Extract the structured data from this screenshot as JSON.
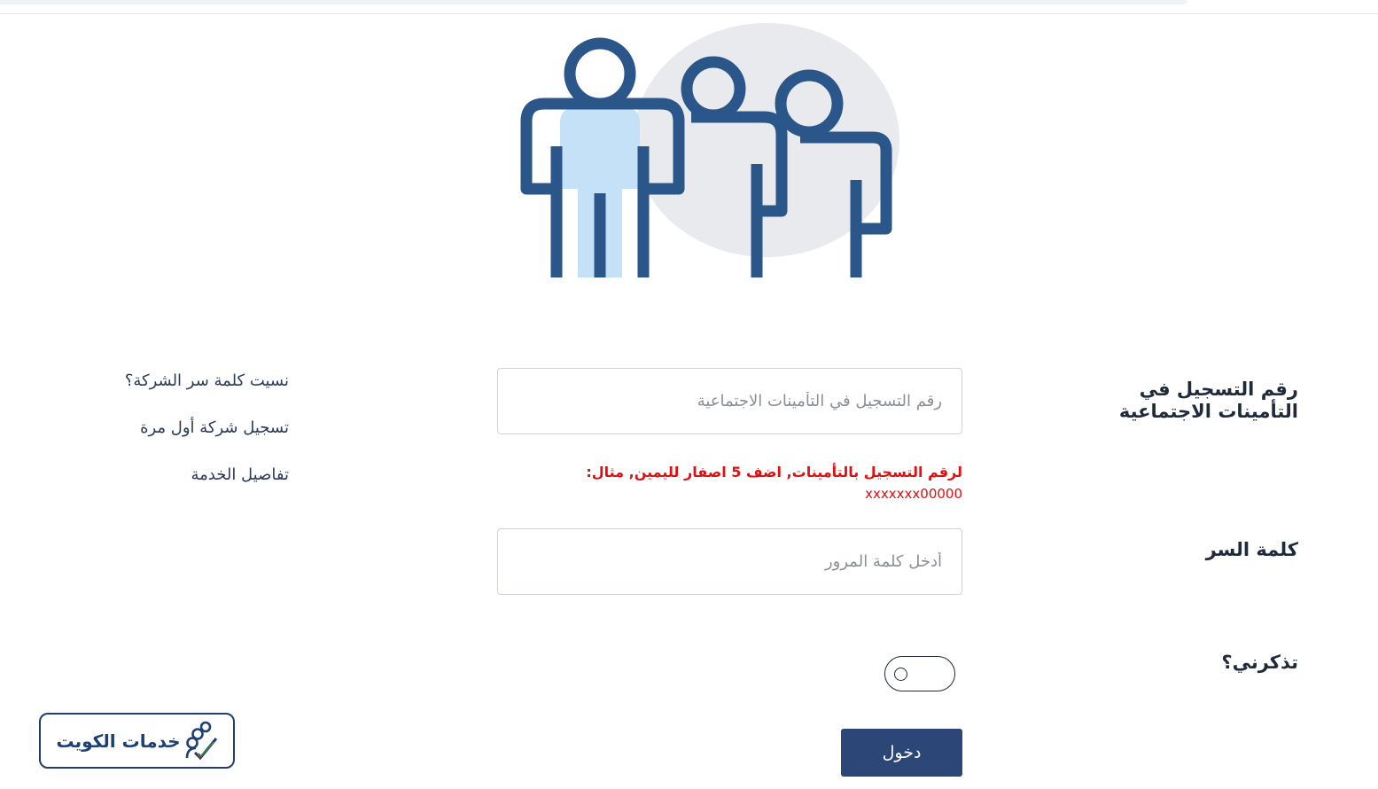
{
  "form": {
    "registration_label": "رقم التسجيل في التأمينات الاجتماعية",
    "registration_placeholder": "رقم التسجيل في التأمينات الاجتماعية",
    "registration_value": "",
    "hint_line1": "لرقم التسجيل بالتأمينات, اضف 5 اصفار لليمين, مثال:",
    "hint_line2": "xxxxxxx00000",
    "password_label": "كلمة السر",
    "password_placeholder": "أدخل كلمة المرور",
    "password_value": "",
    "remember_label": "تذكرني؟",
    "remember_checked": false,
    "login_button": "دخول"
  },
  "links": [
    {
      "label": "نسيت كلمة سر الشركة؟"
    },
    {
      "label": "تسجيل شركة أول مرة"
    },
    {
      "label": "تفاصيل الخدمة"
    }
  ],
  "watermark": {
    "text": "خدمات الكويت"
  },
  "colors": {
    "primary": "#2b4677",
    "error": "#e01010",
    "illustration_stroke": "#2a568a",
    "illustration_fill": "#c5e1f7",
    "illustration_bg": "#e9eaee"
  },
  "icons": {
    "hero": "people-group-icon",
    "logo": "people-check-icon"
  }
}
